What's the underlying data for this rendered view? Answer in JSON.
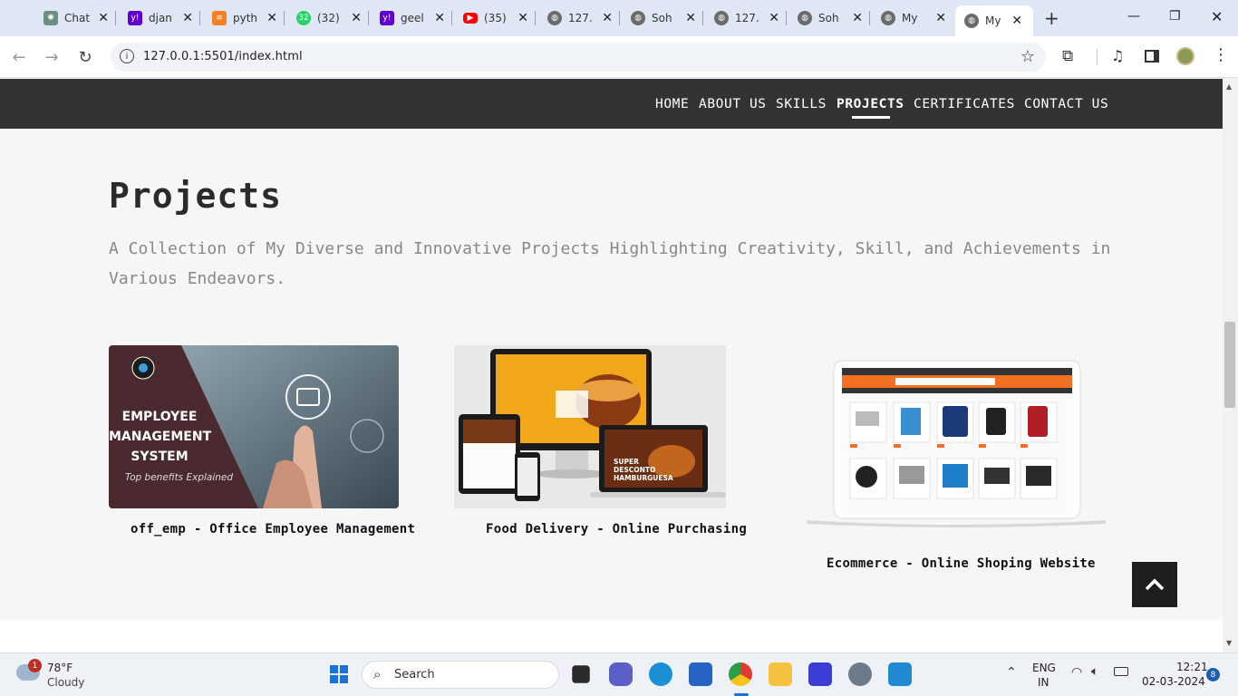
{
  "browser": {
    "tabs": [
      {
        "title": "Chat",
        "icon": "chatgpt-icon",
        "color": "#6b8f7e"
      },
      {
        "title": "djan",
        "icon": "yahoo-icon",
        "color": "#5f01d1"
      },
      {
        "title": "pyth",
        "icon": "stackoverflow-icon",
        "color": "#f48024"
      },
      {
        "title": "(32)",
        "icon": "whatsapp-icon",
        "color": "#25d366"
      },
      {
        "title": "geel",
        "icon": "yahoo-icon",
        "color": "#5f01d1"
      },
      {
        "title": "(35)",
        "icon": "youtube-icon",
        "color": "#ff0000"
      },
      {
        "title": "127.",
        "icon": "globe-icon",
        "color": "#6b6b6b"
      },
      {
        "title": "Soh",
        "icon": "globe-icon",
        "color": "#6b6b6b"
      },
      {
        "title": "127.",
        "icon": "globe-icon",
        "color": "#6b6b6b"
      },
      {
        "title": "Soh",
        "icon": "globe-icon",
        "color": "#6b6b6b"
      },
      {
        "title": "My",
        "icon": "globe-icon",
        "color": "#6b6b6b"
      },
      {
        "title": "My",
        "icon": "globe-icon",
        "color": "#6b6b6b"
      }
    ],
    "url": "127.0.0.1:5501/index.html"
  },
  "site": {
    "nav": [
      "HOME",
      "ABOUT US",
      "SKILLS",
      "PROJECTS",
      "CERTIFICATES",
      "CONTACT US"
    ],
    "active_nav": "PROJECTS",
    "section_title": "Projects",
    "section_subtitle": "A Collection of My Diverse and Innovative Projects Highlighting Creativity, Skill, and Achievements in Various Endeavors.",
    "projects": [
      {
        "caption": "off_emp - Office Employee Management",
        "image_text": {
          "line1": "EMPLOYEE",
          "line2": "MANAGEMENT",
          "line3": "SYSTEM",
          "tag": "Top benefits Explained"
        }
      },
      {
        "caption": "Food Delivery - Online Purchasing",
        "image_text": {
          "banner": "SUPER DESCONTO HAMBURGUESA"
        }
      },
      {
        "caption": "Ecommerce - Online Shoping Website",
        "image_text": {}
      }
    ],
    "back_to_top_icon": "chevron-up-icon"
  },
  "taskbar": {
    "weather": {
      "temp": "78°F",
      "desc": "Cloudy",
      "badge": "1"
    },
    "search_label": "Search",
    "language": {
      "line1": "ENG",
      "line2": "IN"
    },
    "time": "12:21",
    "date": "02-03-2024",
    "notification_count": "8"
  }
}
